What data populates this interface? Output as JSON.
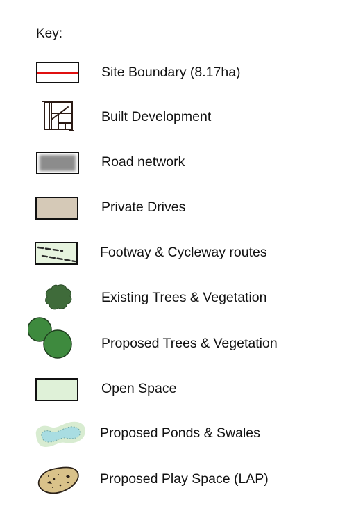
{
  "legend": {
    "title": "Key:",
    "items": [
      {
        "label": "Site Boundary (8.17ha)",
        "icon": "site-boundary-icon"
      },
      {
        "label": "Built Development",
        "icon": "built-development-icon"
      },
      {
        "label": "Road network",
        "icon": "road-network-icon"
      },
      {
        "label": "Private Drives",
        "icon": "private-drives-icon"
      },
      {
        "label": "Footway & Cycleway routes",
        "icon": "footway-cycleway-icon"
      },
      {
        "label": "Existing Trees & Vegetation",
        "icon": "existing-trees-icon"
      },
      {
        "label": "Proposed Trees & Vegetation",
        "icon": "proposed-trees-icon"
      },
      {
        "label": "Open Space",
        "icon": "open-space-icon"
      },
      {
        "label": "Proposed Ponds & Swales",
        "icon": "ponds-swales-icon"
      },
      {
        "label": "Proposed Play Space (LAP)",
        "icon": "play-space-icon"
      }
    ],
    "colors": {
      "boundary_line": "#e01010",
      "road": "#8c8c8c",
      "private_drive": "#d5c9b7",
      "footway_fill": "#e6f3de",
      "existing_tree": "#3f6b3a",
      "proposed_tree": "#3e8a3e",
      "open_space": "#dff1d8",
      "pond_water": "#a9dde2",
      "play_space": "#d9c28a"
    }
  }
}
